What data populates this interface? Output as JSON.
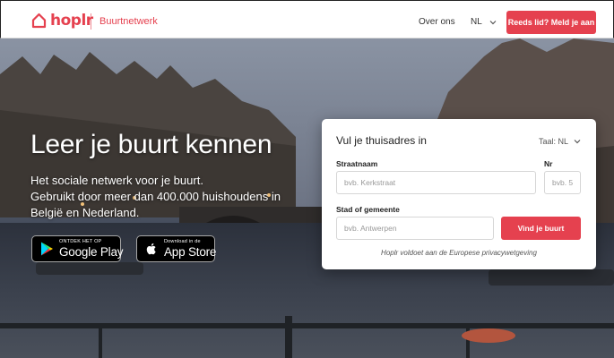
{
  "header": {
    "brand": "hoplr",
    "subtitle": "Buurtnetwerk",
    "nav_about": "Over ons",
    "nav_lang": "NL",
    "login_button": "Reeds lid? Meld je aan"
  },
  "hero": {
    "title": "Leer je buurt kennen",
    "subtitle_lines": [
      "Het sociale netwerk voor je buurt.",
      "Gebruikt door meer dan 400.000 huishoudens in",
      "België en Nederland."
    ]
  },
  "stores": {
    "google_small": "ONTDEK HET OP",
    "google_big": "Google Play",
    "apple_small": "Download in de",
    "apple_big": "App Store"
  },
  "form": {
    "title": "Vul je thuisadres in",
    "language_label": "Taal: NL",
    "street_label": "Straatnaam",
    "street_placeholder": "bvb. Kerkstraat",
    "number_label": "Nr",
    "number_placeholder": "bvb. 5",
    "city_label": "Stad of gemeente",
    "city_placeholder": "bvb. Antwerpen",
    "submit_label": "Vind je buurt",
    "privacy_note": "Hoplr voldoet aan de Europese privacywetgeving"
  },
  "colors": {
    "brand_red": "#e5414f",
    "header_bg": "#ffffff",
    "card_bg": "#ffffff"
  },
  "icons": {
    "logo": "house-icon",
    "chevron": "chevron-down-icon",
    "google": "google-play-icon",
    "apple": "apple-icon"
  }
}
